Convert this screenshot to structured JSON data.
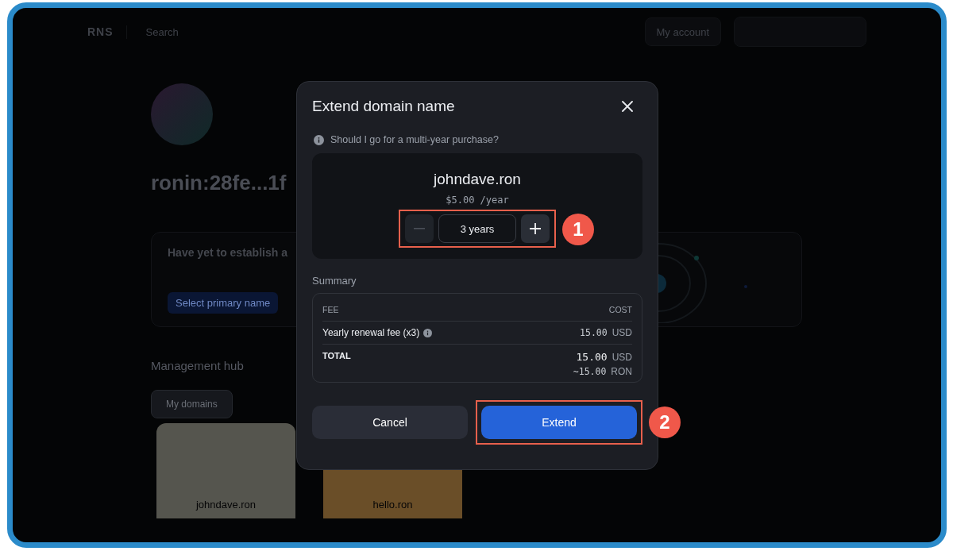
{
  "background": {
    "logo": "RNS",
    "search": {
      "placeholder": "Search"
    },
    "account_button": "My account",
    "profile": {
      "title": "ronin:28fe...1f"
    },
    "primary_card": {
      "title": "Have yet to establish a",
      "button": "Select primary name"
    },
    "hub": {
      "title": "Management hub",
      "tabs": [
        {
          "label": "My domains",
          "selected": true
        }
      ],
      "cards": [
        {
          "name": "johndave.ron",
          "color": "#55554e"
        },
        {
          "name": "hello.ron",
          "color": "#6a4e28"
        }
      ]
    }
  },
  "dialog": {
    "title": "Extend domain name",
    "hint": "Should I go for a multi-year purchase?",
    "domain": {
      "name": "johndave.ron",
      "price": "$5.00 /year"
    },
    "duration": {
      "value": "3 years",
      "decrease_disabled": true,
      "annotation": "1"
    },
    "summary": {
      "title": "Summary",
      "columns": [
        "FEE",
        "COST"
      ],
      "rows": [
        {
          "label": "Yearly renewal fee (x3)",
          "info": true,
          "amount": "15.00",
          "unit": "USD"
        }
      ],
      "total": {
        "label": "TOTAL",
        "amount": "15.00",
        "unit": "USD",
        "alt_amount": "~15.00",
        "alt_unit": "RON"
      }
    },
    "buttons": [
      {
        "label": "Cancel",
        "kind": "secondary"
      },
      {
        "label": "Extend",
        "kind": "primary",
        "annotation": "2"
      }
    ]
  }
}
